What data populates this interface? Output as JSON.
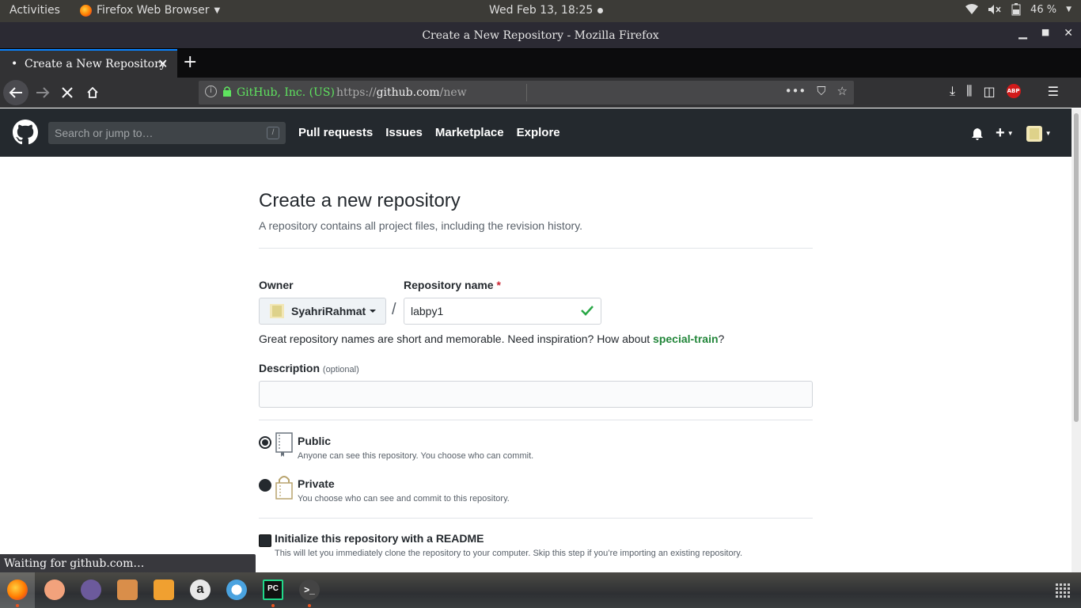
{
  "topbar": {
    "activities": "Activities",
    "app_menu": "Firefox Web Browser",
    "clock": "Wed Feb 13, 18:25",
    "battery": "46 %"
  },
  "window": {
    "title": "Create a New Repository - Mozilla Firefox"
  },
  "tabs": [
    {
      "label": "Create a New Repository",
      "active": true
    }
  ],
  "navbar": {
    "identity": "GitHub, Inc. (US)",
    "url_prefix": "https://",
    "url_domain": "github.com",
    "url_path": "/new",
    "abp_label": "ABP"
  },
  "github": {
    "search_placeholder": "Search or jump to…",
    "search_key": "/",
    "nav": [
      "Pull requests",
      "Issues",
      "Marketplace",
      "Explore"
    ]
  },
  "form": {
    "title": "Create a new repository",
    "subtitle": "A repository contains all project files, including the revision history.",
    "owner_label": "Owner",
    "owner_value": "SyahriRahmat",
    "separator": "/",
    "repo_label": "Repository name",
    "required_mark": "*",
    "repo_value": "labpy1",
    "hint_prefix": "Great repository names are short and memorable. Need inspiration? How about ",
    "hint_suggestion": "special-train",
    "hint_suffix": "?",
    "description_label": "Description",
    "description_optional": "(optional)",
    "description_value": "",
    "visibility": [
      {
        "title": "Public",
        "note": "Anyone can see this repository. You choose who can commit.",
        "selected": true
      },
      {
        "title": "Private",
        "note": "You choose who can see and commit to this repository.",
        "selected": false
      }
    ],
    "readme_title": "Initialize this repository with a README",
    "readme_note": "This will let you immediately clone the repository to your computer. Skip this step if you’re importing an existing repository."
  },
  "status": "Waiting for github.com…",
  "colors": {
    "gh_header": "#24292e",
    "accent_green": "#22863a",
    "required_red": "#cb2431",
    "tab_accent": "#0a84ff"
  }
}
